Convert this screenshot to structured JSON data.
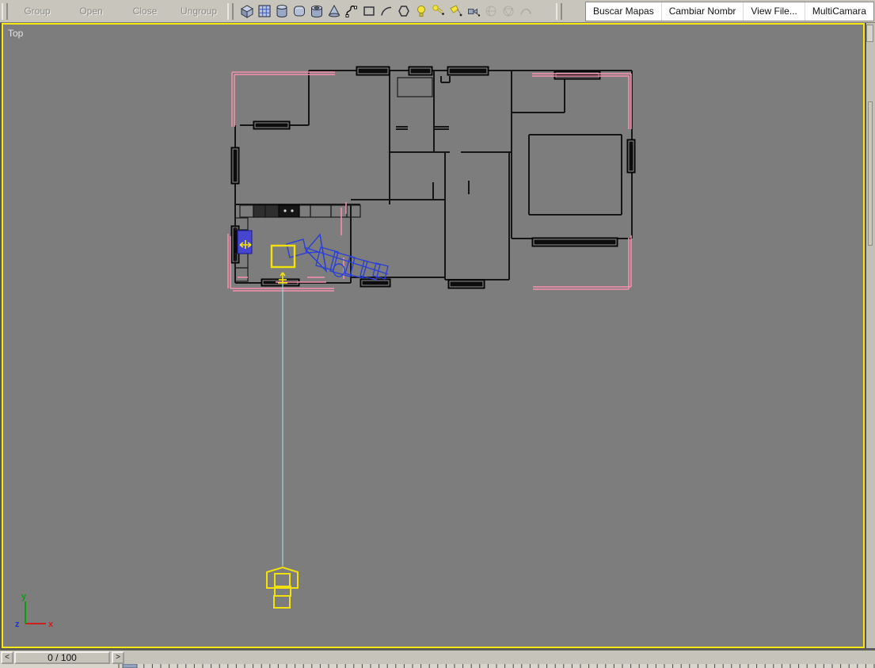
{
  "colors": {
    "toolbar_bg": "#c8c5bd",
    "viewport_bg": "#7d7d7d",
    "viewport_border": "#f8e716",
    "wall": "#151515",
    "pink": "#f791ad",
    "blue": "#2b3fd6",
    "sink_fill": "#4646d0",
    "yellow": "#f2e20c",
    "cyan": "#a5d6d6",
    "axis_x": "#cf2020",
    "axis_y": "#0aa00a",
    "axis_z": "#2233cc",
    "script_panel_bg": "#ffffff"
  },
  "toolbar": {
    "group_buttons": [
      {
        "label": "Group"
      },
      {
        "label": "Open"
      },
      {
        "label": "Close"
      },
      {
        "label": "Ungroup"
      }
    ],
    "icons": [
      "box-icon",
      "grid-plane-icon",
      "cylinder-icon",
      "chamfer-box-icon",
      "tube-icon",
      "cone-icon",
      "spline-icon",
      "rectangle-icon",
      "arc-icon",
      "circle-icon",
      "omni-light-icon",
      "target-spot-light-icon",
      "free-spot-light-icon",
      "target-camera-icon",
      "disabled-sphere-icon",
      "disabled-geosphere-icon",
      "disabled-bind-icon"
    ],
    "script_buttons": [
      {
        "label": "Buscar Mapas"
      },
      {
        "label": "Cambiar Nombr"
      },
      {
        "label": "View File..."
      },
      {
        "label": "MultiCamara"
      }
    ]
  },
  "viewport": {
    "label": "Top"
  },
  "axis_labels": {
    "x": "x",
    "y": "y",
    "z": "z"
  },
  "timeline": {
    "prev": "<",
    "frame_display": "0 / 100",
    "next": ">"
  },
  "floorplan": {
    "walls": [
      [
        390,
        89,
        798,
        89
      ],
      [
        798,
        89,
        798,
        301
      ],
      [
        646,
        301,
        798,
        301
      ],
      [
        646,
        89,
        646,
        301
      ],
      [
        646,
        142,
        713,
        142
      ],
      [
        713,
        89,
        713,
        142
      ],
      [
        668,
        170,
        785,
        170
      ],
      [
        785,
        170,
        785,
        271
      ],
      [
        668,
        271,
        785,
        271
      ],
      [
        668,
        170,
        668,
        271
      ],
      [
        390,
        89,
        390,
        158
      ],
      [
        303,
        158,
        390,
        158
      ],
      [
        297,
        158,
        297,
        357
      ],
      [
        297,
        258,
        455,
        258
      ],
      [
        443,
        258,
        443,
        357
      ],
      [
        297,
        357,
        443,
        357
      ],
      [
        492,
        89,
        492,
        258
      ],
      [
        548,
        89,
        548,
        192
      ],
      [
        492,
        192,
        568,
        192
      ],
      [
        582,
        192,
        646,
        192
      ],
      [
        562,
        192,
        562,
        353
      ],
      [
        643,
        192,
        643,
        353
      ],
      [
        562,
        353,
        643,
        353
      ],
      [
        443,
        252,
        562,
        252
      ],
      [
        547,
        230,
        547,
        252
      ],
      [
        443,
        350,
        562,
        350
      ],
      [
        562,
        350,
        562,
        353
      ],
      [
        592,
        228,
        592,
        245
      ],
      [
        557,
        96,
        557,
        104
      ],
      [
        557,
        104,
        568,
        104
      ],
      [
        568,
        96,
        568,
        104
      ],
      [
        500,
        160,
        515,
        160
      ],
      [
        500,
        163,
        515,
        163
      ],
      [
        548,
        160,
        567,
        160
      ],
      [
        548,
        163,
        567,
        163
      ]
    ],
    "closet": [
      502,
      98,
      44,
      24
    ],
    "windows": [
      [
        450,
        84,
        42,
        11
      ],
      [
        516,
        84,
        30,
        11
      ],
      [
        565,
        84,
        52,
        11
      ],
      [
        700,
        90,
        58,
        10
      ],
      [
        320,
        153,
        46,
        10
      ],
      [
        292,
        186,
        10,
        46
      ],
      [
        292,
        285,
        10,
        47
      ],
      [
        792,
        176,
        10,
        42
      ],
      [
        330,
        352,
        48,
        9
      ],
      [
        455,
        352,
        38,
        10
      ],
      [
        566,
        353,
        46,
        11
      ],
      [
        672,
        300,
        108,
        11
      ]
    ],
    "counters": [
      [
        303,
        259,
        17,
        15
      ],
      [
        320,
        259,
        15,
        15
      ],
      [
        335,
        259,
        17,
        15
      ],
      [
        378,
        259,
        14,
        15
      ],
      [
        392,
        259,
        26,
        15
      ],
      [
        418,
        259,
        20,
        15
      ],
      [
        438,
        259,
        17,
        15
      ],
      [
        297,
        275,
        16,
        15
      ],
      [
        297,
        320,
        16,
        18
      ],
      [
        297,
        338,
        16,
        17
      ]
    ],
    "dark_cells": [
      [
        320,
        259,
        15,
        15
      ],
      [
        335,
        259,
        17,
        15
      ]
    ],
    "stove": [
      352,
      259,
      26,
      15
    ],
    "sink": [
      300,
      291,
      18,
      29
    ],
    "pink_lines": [
      [
        293,
        91,
        423,
        91
      ],
      [
        296,
        94,
        423,
        94
      ],
      [
        293,
        91,
        293,
        160
      ],
      [
        296,
        94,
        296,
        160
      ],
      [
        672,
        93,
        797,
        93
      ],
      [
        672,
        96,
        794,
        96
      ],
      [
        797,
        93,
        797,
        163
      ],
      [
        794,
        96,
        794,
        163
      ],
      [
        673,
        362,
        797,
        362
      ],
      [
        673,
        365,
        794,
        365
      ],
      [
        797,
        297,
        797,
        362
      ],
      [
        794,
        300,
        794,
        365
      ],
      [
        291,
        364,
        422,
        364
      ],
      [
        294,
        367,
        422,
        367
      ],
      [
        288,
        295,
        288,
        364
      ],
      [
        291,
        298,
        291,
        364
      ],
      [
        300,
        350,
        313,
        350
      ],
      [
        388,
        350,
        410,
        350
      ],
      [
        348,
        356,
        412,
        356
      ],
      [
        431,
        262,
        431,
        297
      ],
      [
        434,
        325,
        434,
        352
      ],
      [
        437,
        255,
        437,
        270
      ]
    ],
    "blue_polys": [
      [
        [
          362,
          308
        ],
        [
          383,
          302
        ],
        [
          387,
          319
        ],
        [
          366,
          325
        ]
      ],
      [
        [
          387,
          316
        ],
        [
          404,
          296
        ],
        [
          412,
          342
        ]
      ],
      [
        [
          405,
          312
        ],
        [
          427,
          318
        ],
        [
          421,
          341
        ],
        [
          399,
          335
        ]
      ],
      [
        [
          423,
          318
        ],
        [
          448,
          325
        ],
        [
          442,
          349
        ],
        [
          417,
          342
        ]
      ],
      [
        [
          442,
          324
        ],
        [
          464,
          330
        ],
        [
          458,
          351
        ],
        [
          436,
          345
        ]
      ],
      [
        [
          460,
          329
        ],
        [
          480,
          334
        ],
        [
          475,
          353
        ],
        [
          455,
          348
        ]
      ],
      [
        [
          475,
          332
        ],
        [
          490,
          336
        ],
        [
          486,
          352
        ],
        [
          471,
          348
        ]
      ]
    ],
    "blue_lines": [
      [
        384,
        312,
        490,
        346
      ],
      [
        404,
        296,
        412,
        342
      ],
      [
        387,
        319,
        404,
        318
      ]
    ],
    "blue_ellipse": [
      428,
      341,
      7,
      8
    ],
    "selection_square": [
      343,
      310,
      29,
      27
    ],
    "camera_polys": [
      [
        [
          337,
          742
        ],
        [
          337,
          722
        ],
        [
          357,
          716
        ],
        [
          376,
          722
        ],
        [
          376,
          742
        ]
      ]
    ],
    "camera_rects": [
      [
        347,
        724,
        19,
        16
      ],
      [
        347,
        740,
        20,
        12
      ],
      [
        346,
        752,
        20,
        15
      ]
    ],
    "tripod_lines": [
      [
        303,
        309,
        317,
        309
      ],
      [
        310,
        303,
        310,
        314
      ],
      [
        303,
        309,
        307,
        306
      ],
      [
        303,
        309,
        307,
        312
      ],
      [
        317,
        309,
        313,
        306
      ],
      [
        317,
        309,
        313,
        312
      ],
      [
        357,
        344,
        357,
        357
      ],
      [
        357,
        344,
        354,
        348
      ],
      [
        357,
        344,
        360,
        348
      ],
      [
        352,
        353,
        362,
        353
      ],
      [
        351,
        357,
        363,
        357
      ]
    ],
    "target_line": [
      357,
      357,
      357,
      714
    ],
    "axis": {
      "origin": [
        32,
        787
      ],
      "x_end": [
        58,
        787
      ],
      "y_end": [
        32,
        759
      ],
      "labels": {
        "x": [
          61,
          791
        ],
        "y": [
          27,
          756
        ],
        "z": [
          19,
          791
        ]
      }
    }
  }
}
